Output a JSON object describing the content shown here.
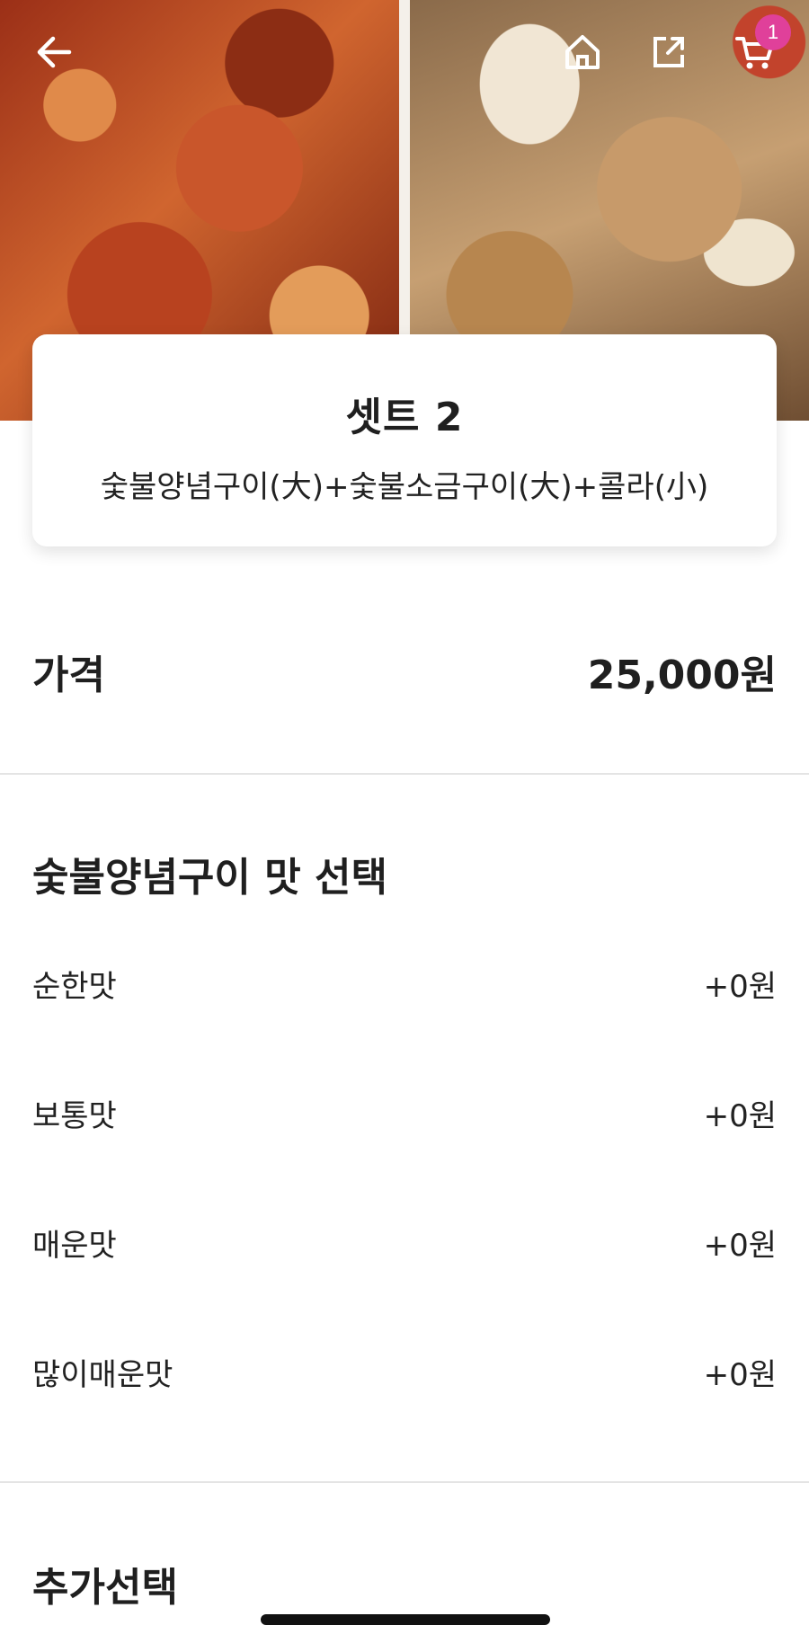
{
  "header": {
    "back_icon": "back-arrow-icon",
    "home_icon": "home-icon",
    "share_icon": "share-icon",
    "cart_icon": "cart-icon",
    "cart_count": "1",
    "badge_color": "#e0409a"
  },
  "menu": {
    "name": "셋트 2",
    "description": "숯불양념구이(大)+숯불소금구이(大)+콜라(小)"
  },
  "price": {
    "label": "가격",
    "value": "25,000원"
  },
  "flavor_section": {
    "title": "숯불양념구이 맛 선택",
    "options": [
      {
        "label": "순한맛",
        "price": "+0원"
      },
      {
        "label": "보통맛",
        "price": "+0원"
      },
      {
        "label": "매운맛",
        "price": "+0원"
      },
      {
        "label": "많이매운맛",
        "price": "+0원"
      }
    ]
  },
  "extra_section": {
    "title": "추가선택"
  }
}
